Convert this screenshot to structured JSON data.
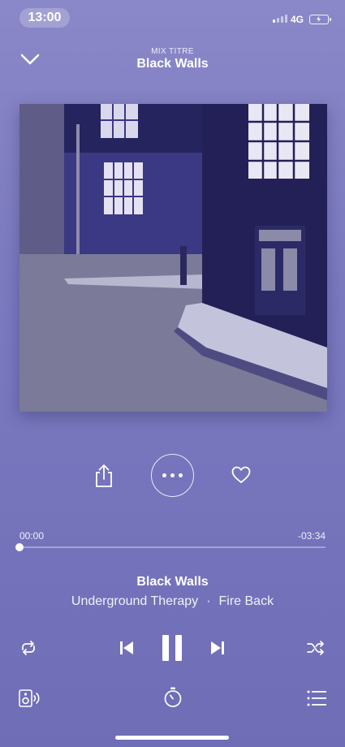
{
  "status_bar": {
    "time": "13:00",
    "network": "4G",
    "signal_bars_active": 1,
    "battery_state": "charging"
  },
  "header": {
    "context_label": "MIX TITRE",
    "title": "Black Walls",
    "collapse_icon": "chevron-down-icon"
  },
  "artwork": {
    "description_colors": {
      "sky": "#2f2c70",
      "wall": "#3d3a86",
      "street": "#7a7996",
      "window_light": "#e9e7f4"
    }
  },
  "actions": {
    "share_icon": "share-icon",
    "more_icon": "more-horizontal-icon",
    "like_icon": "heart-icon"
  },
  "progress": {
    "elapsed": "00:00",
    "remaining": "-03:34",
    "fraction": 0.0
  },
  "track": {
    "title": "Black Walls",
    "artist": "Underground Therapy",
    "separator": "·",
    "album": "Fire Back"
  },
  "controls": {
    "repeat_icon": "repeat-icon",
    "previous_icon": "skip-previous-icon",
    "pause_icon": "pause-icon",
    "next_icon": "skip-next-icon",
    "shuffle_icon": "shuffle-icon"
  },
  "bottom_bar": {
    "device_icon": "speaker-icon",
    "timer_icon": "sleep-timer-icon",
    "queue_icon": "queue-icon"
  },
  "colors": {
    "background_top": "#8a88c8",
    "background_bottom": "#6f6db6",
    "foreground": "#ffffff"
  }
}
